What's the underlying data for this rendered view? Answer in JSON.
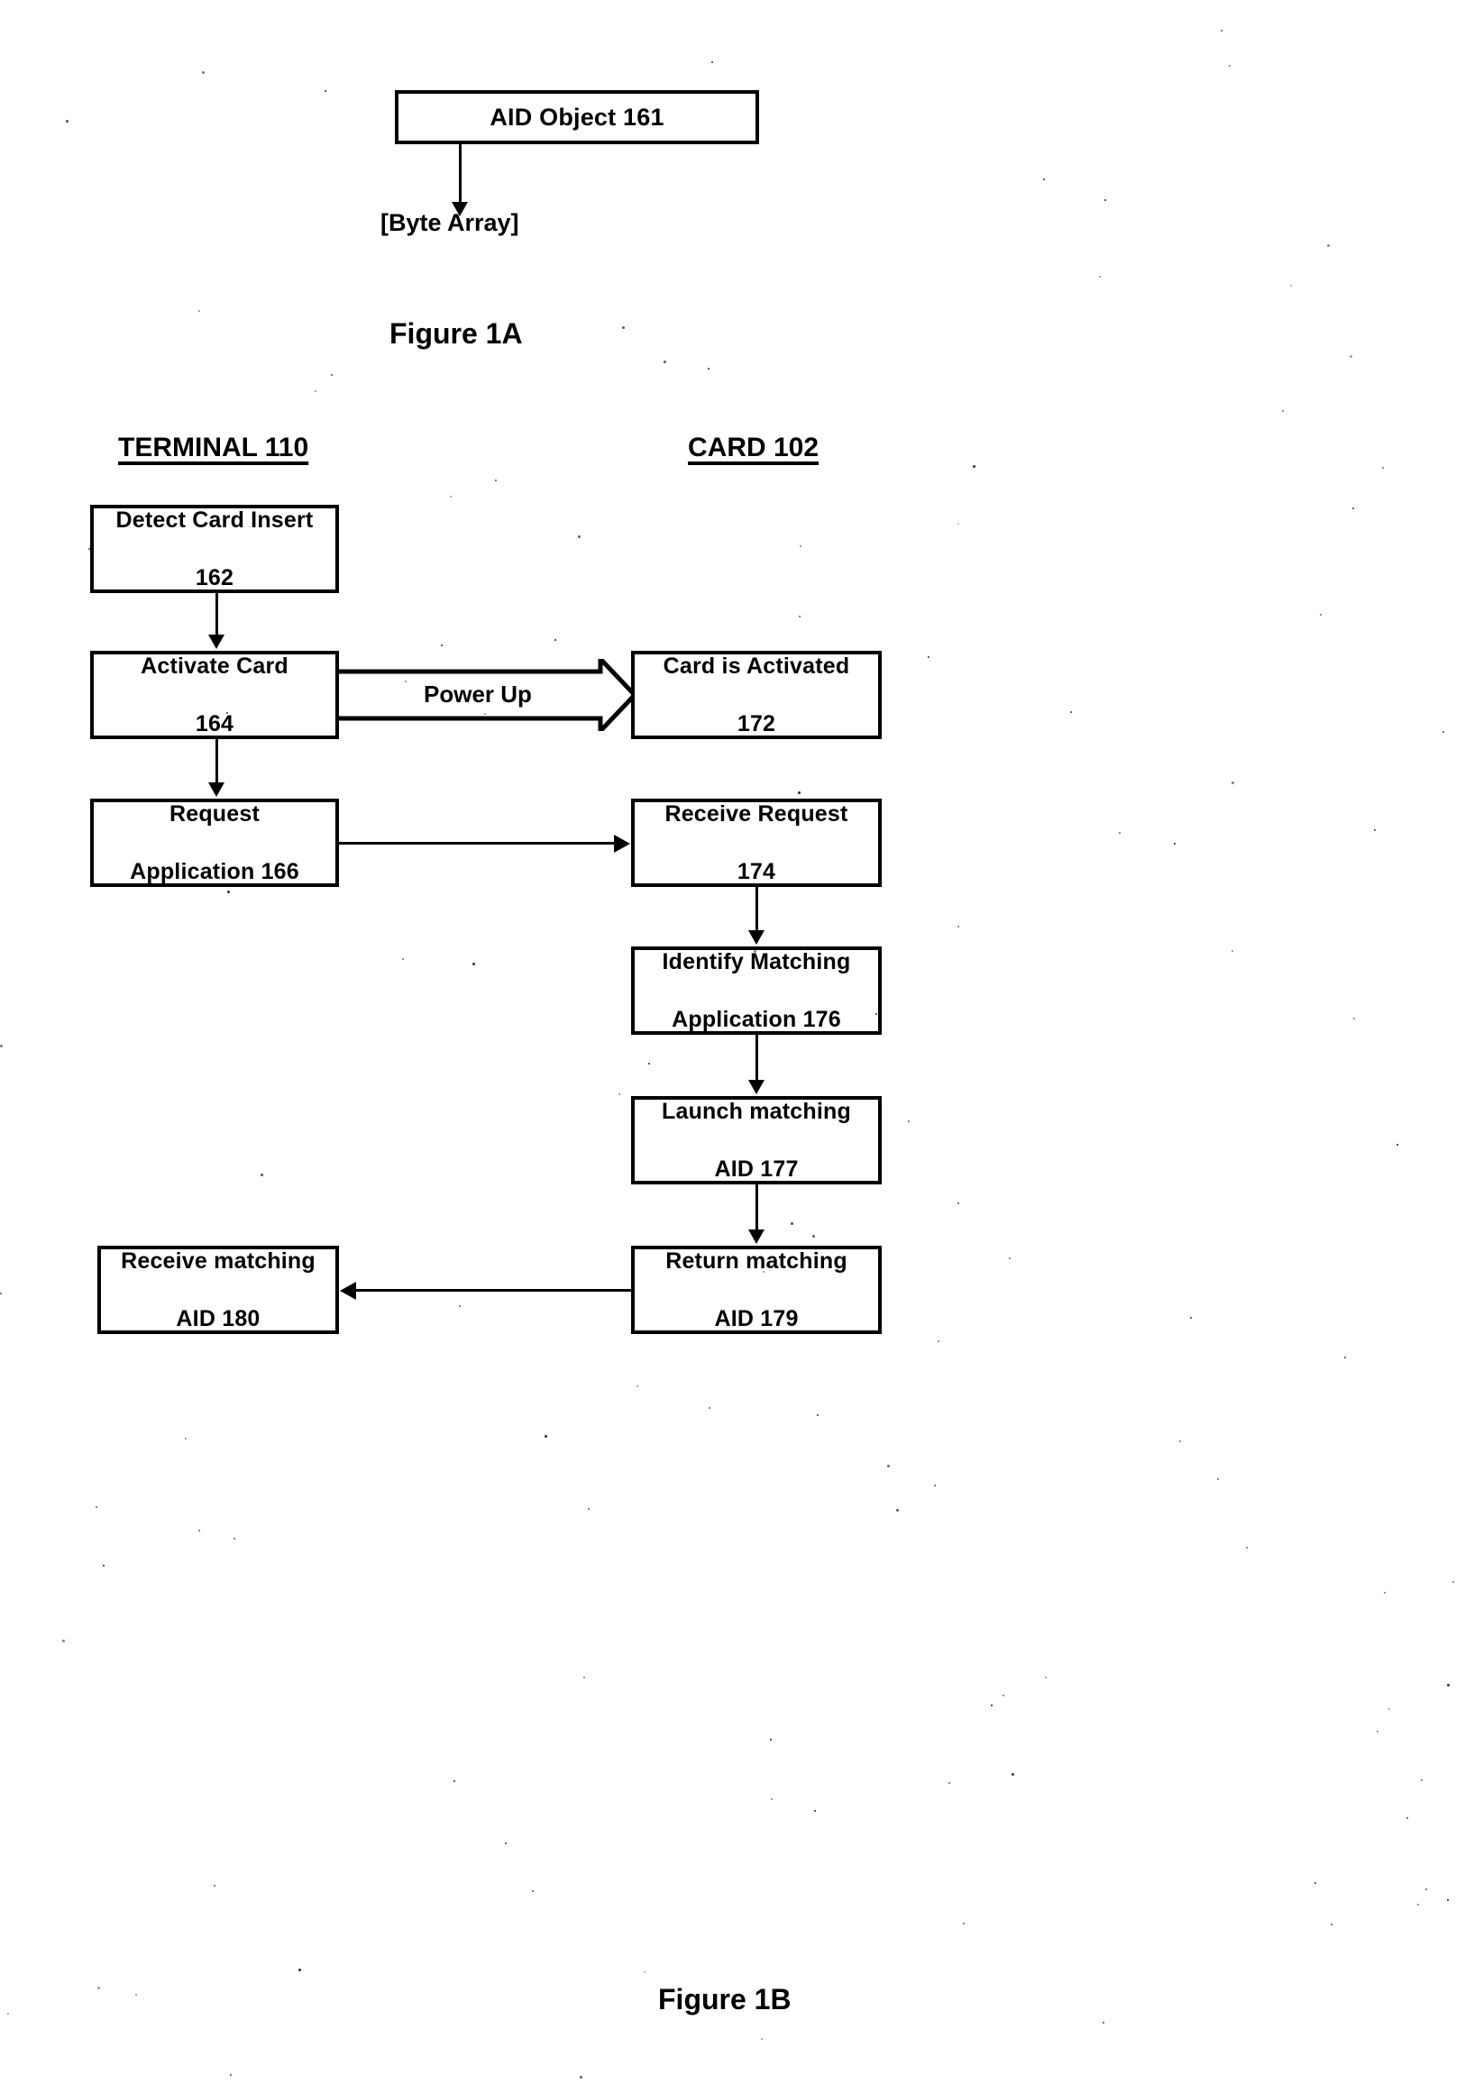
{
  "figure_1a": {
    "caption": "Figure 1A",
    "aid_object_box": "AID Object 161",
    "byte_array_label": "[Byte Array]"
  },
  "figure_1b": {
    "caption": "Figure 1B",
    "lanes": {
      "terminal": "TERMINAL 110",
      "card": "CARD 102"
    },
    "terminal_nodes": [
      {
        "id": "detect-card-insert",
        "line1": "Detect Card Insert",
        "line2": "162"
      },
      {
        "id": "activate-card",
        "line1": "Activate Card",
        "line2": "164"
      },
      {
        "id": "request-application",
        "line1": "Request",
        "line2": "Application 166"
      },
      {
        "id": "receive-matching-aid",
        "line1": "Receive matching",
        "line2": "AID 180"
      }
    ],
    "card_nodes": [
      {
        "id": "card-is-activated",
        "line1": "Card is Activated",
        "line2": "172"
      },
      {
        "id": "receive-request",
        "line1": "Receive Request",
        "line2": "174"
      },
      {
        "id": "identify-matching-application",
        "line1": "Identify Matching",
        "line2": "Application 176"
      },
      {
        "id": "launch-matching-aid",
        "line1": "Launch matching",
        "line2": "AID 177"
      },
      {
        "id": "return-matching-aid",
        "line1": "Return matching",
        "line2": "AID 179"
      }
    ],
    "edge_labels": {
      "power_up": "Power Up"
    }
  },
  "colors": {
    "ink": "#000000",
    "paper": "#ffffff"
  }
}
